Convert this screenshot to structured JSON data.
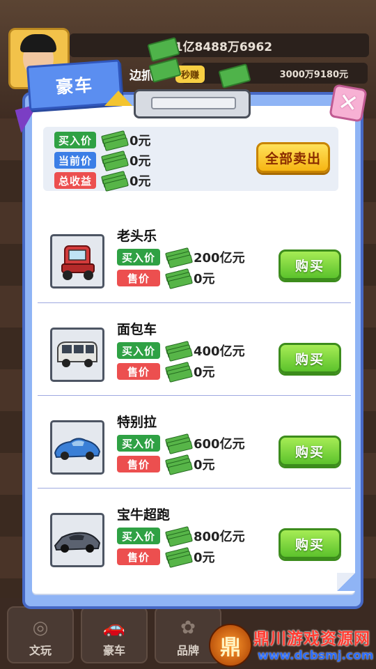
{
  "hud": {
    "total_money": "61亿8488万6962",
    "income_rate": "3000万9180元",
    "bg_label_left": "边抓",
    "bg_label_fast": "秒赚"
  },
  "modal": {
    "title": "豪车",
    "close_symbol": "✕",
    "summary": {
      "buy_price_label": "买入价",
      "buy_price_value": "0元",
      "current_price_label": "当前价",
      "current_price_value": "0元",
      "total_profit_label": "总收益",
      "total_profit_value": "0元",
      "sell_all_label": "全部卖出"
    },
    "cars": [
      {
        "name": "老头乐",
        "buy_label": "买入价",
        "buy_value": "200亿元",
        "sell_label": "售价",
        "sell_value": "0元",
        "button": "购买",
        "thumb": "red-mobility-scooter"
      },
      {
        "name": "面包车",
        "buy_label": "买入价",
        "buy_value": "400亿元",
        "sell_label": "售价",
        "sell_value": "0元",
        "button": "购买",
        "thumb": "white-minivan"
      },
      {
        "name": "特别拉",
        "buy_label": "买入价",
        "buy_value": "600亿元",
        "sell_label": "售价",
        "sell_value": "0元",
        "button": "购买",
        "thumb": "blue-sports-car"
      },
      {
        "name": "宝牛超跑",
        "buy_label": "买入价",
        "buy_value": "800亿元",
        "sell_label": "售价",
        "sell_value": "0元",
        "button": "购买",
        "thumb": "gray-supercar"
      }
    ]
  },
  "bottom_nav": {
    "tabs": [
      {
        "label": "文玩",
        "icon": "beads-icon"
      },
      {
        "label": "豪车",
        "icon": "car-icon"
      },
      {
        "label": "品牌",
        "icon": "brand-icon"
      }
    ]
  },
  "watermark": {
    "logo_char": "鼎",
    "name": "鼎川游戏资源网",
    "url": "www.dcbsmj.com"
  },
  "colors": {
    "modal_blue": "#8fb4f5",
    "green_badge": "#2fa144",
    "blue_badge": "#3b7ee6",
    "red_badge": "#ec4f4f",
    "sell_all_yellow": "#f6b513",
    "buy_green": "#5cc22c"
  }
}
